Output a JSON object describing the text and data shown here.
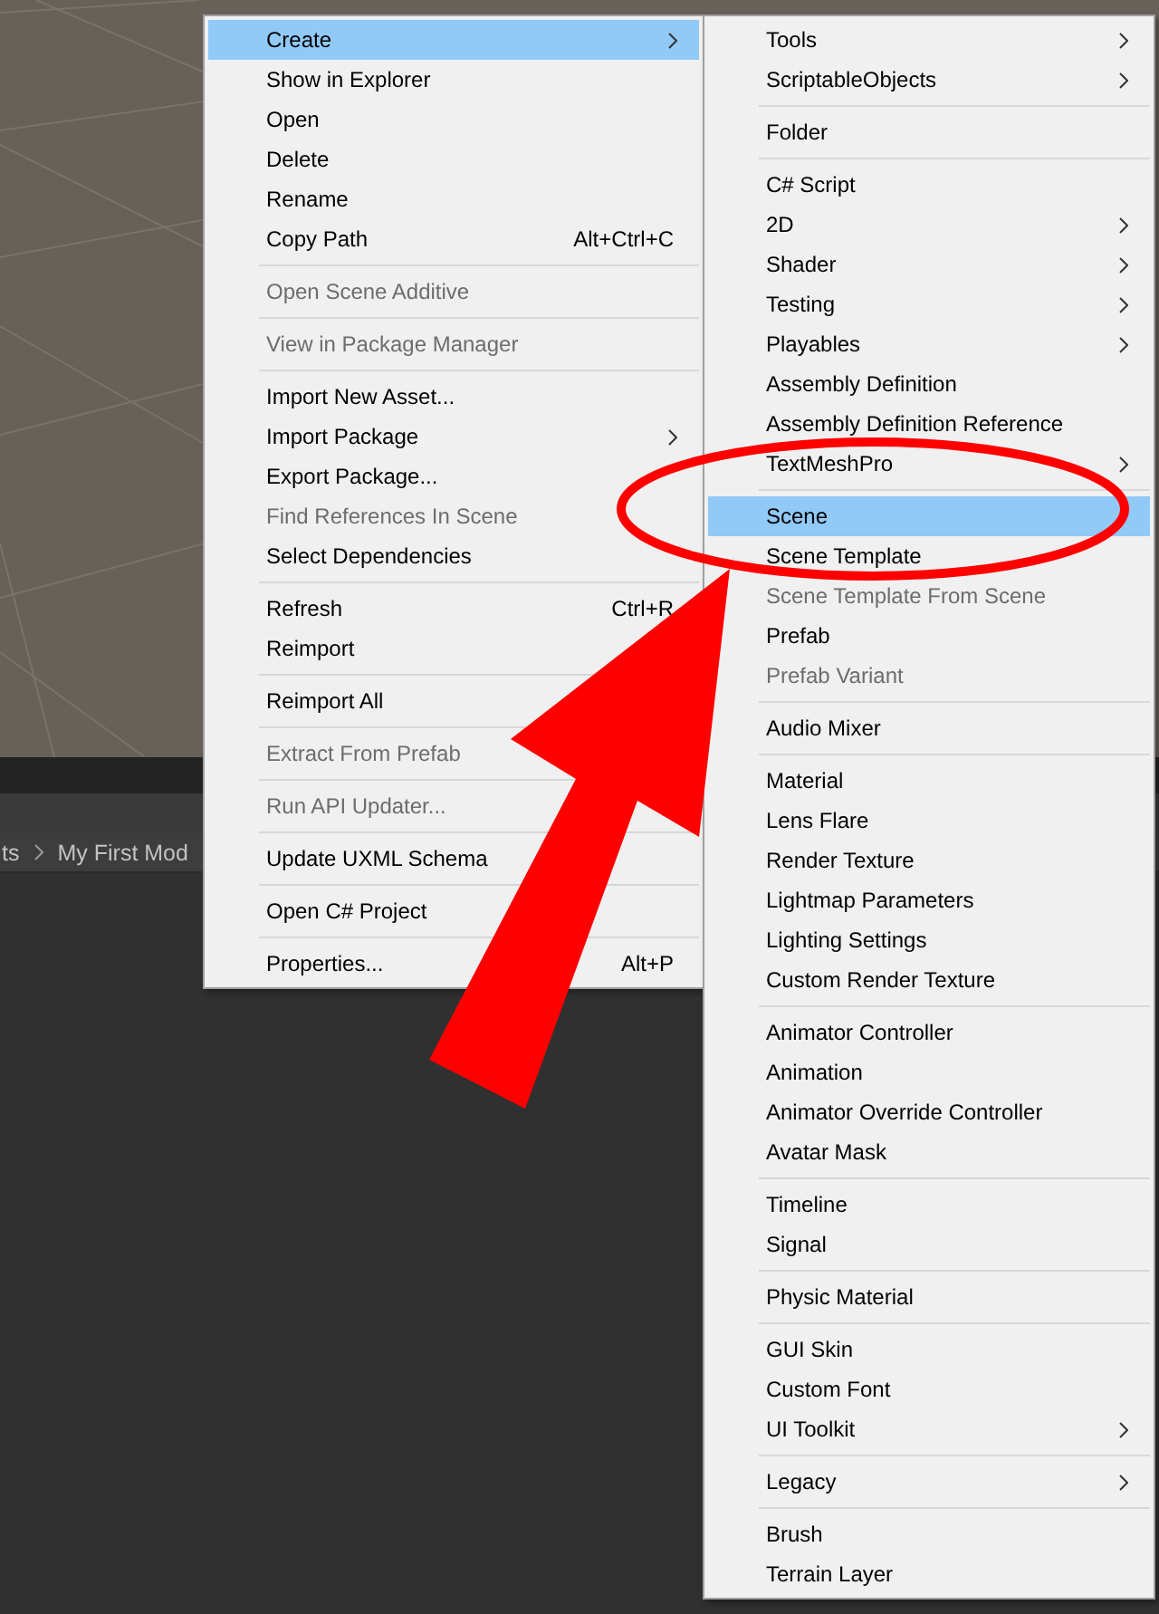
{
  "breadcrumb": [
    "ts",
    "My First Mod"
  ],
  "context_menu": {
    "groups": [
      {
        "items": [
          {
            "label": "Create",
            "submenu": true,
            "disabled": false,
            "selected": true
          },
          {
            "label": "Show in Explorer",
            "submenu": false,
            "disabled": false,
            "selected": false
          },
          {
            "label": "Open",
            "submenu": false,
            "disabled": false,
            "selected": false
          },
          {
            "label": "Delete",
            "submenu": false,
            "disabled": false,
            "selected": false
          },
          {
            "label": "Rename",
            "submenu": false,
            "disabled": false,
            "selected": false
          },
          {
            "label": "Copy Path",
            "shortcut": "Alt+Ctrl+C",
            "submenu": false,
            "disabled": false,
            "selected": false
          }
        ]
      },
      {
        "items": [
          {
            "label": "Open Scene Additive",
            "submenu": false,
            "disabled": true,
            "selected": false
          }
        ]
      },
      {
        "items": [
          {
            "label": "View in Package Manager",
            "submenu": false,
            "disabled": true,
            "selected": false
          }
        ]
      },
      {
        "items": [
          {
            "label": "Import New Asset...",
            "submenu": false,
            "disabled": false,
            "selected": false
          },
          {
            "label": "Import Package",
            "submenu": true,
            "disabled": false,
            "selected": false
          },
          {
            "label": "Export Package...",
            "submenu": false,
            "disabled": false,
            "selected": false
          },
          {
            "label": "Find References In Scene",
            "submenu": false,
            "disabled": true,
            "selected": false
          },
          {
            "label": "Select Dependencies",
            "submenu": false,
            "disabled": false,
            "selected": false
          }
        ]
      },
      {
        "items": [
          {
            "label": "Refresh",
            "shortcut": "Ctrl+R",
            "submenu": false,
            "disabled": false,
            "selected": false
          },
          {
            "label": "Reimport",
            "submenu": false,
            "disabled": false,
            "selected": false
          }
        ]
      },
      {
        "items": [
          {
            "label": "Reimport All",
            "submenu": false,
            "disabled": false,
            "selected": false
          }
        ]
      },
      {
        "items": [
          {
            "label": "Extract From Prefab",
            "submenu": false,
            "disabled": true,
            "selected": false
          }
        ]
      },
      {
        "items": [
          {
            "label": "Run API Updater...",
            "submenu": false,
            "disabled": true,
            "selected": false
          }
        ]
      },
      {
        "items": [
          {
            "label": "Update UXML Schema",
            "submenu": false,
            "disabled": false,
            "selected": false
          }
        ]
      },
      {
        "items": [
          {
            "label": "Open C# Project",
            "submenu": false,
            "disabled": false,
            "selected": false
          }
        ]
      },
      {
        "items": [
          {
            "label": "Properties...",
            "shortcut": "Alt+P",
            "submenu": false,
            "disabled": false,
            "selected": false
          }
        ]
      }
    ]
  },
  "create_submenu": {
    "groups": [
      {
        "items": [
          {
            "label": "Tools",
            "submenu": true,
            "disabled": false,
            "selected": false
          },
          {
            "label": "ScriptableObjects",
            "submenu": true,
            "disabled": false,
            "selected": false
          }
        ]
      },
      {
        "items": [
          {
            "label": "Folder",
            "submenu": false,
            "disabled": false,
            "selected": false
          }
        ]
      },
      {
        "items": [
          {
            "label": "C# Script",
            "submenu": false,
            "disabled": false,
            "selected": false
          },
          {
            "label": "2D",
            "submenu": true,
            "disabled": false,
            "selected": false
          },
          {
            "label": "Shader",
            "submenu": true,
            "disabled": false,
            "selected": false
          },
          {
            "label": "Testing",
            "submenu": true,
            "disabled": false,
            "selected": false
          },
          {
            "label": "Playables",
            "submenu": true,
            "disabled": false,
            "selected": false
          },
          {
            "label": "Assembly Definition",
            "submenu": false,
            "disabled": false,
            "selected": false
          },
          {
            "label": "Assembly Definition Reference",
            "submenu": false,
            "disabled": false,
            "selected": false
          },
          {
            "label": "TextMeshPro",
            "submenu": true,
            "disabled": false,
            "selected": false
          }
        ]
      },
      {
        "items": [
          {
            "label": "Scene",
            "submenu": false,
            "disabled": false,
            "selected": true
          },
          {
            "label": "Scene Template",
            "submenu": false,
            "disabled": false,
            "selected": false
          },
          {
            "label": "Scene Template From Scene",
            "submenu": false,
            "disabled": true,
            "selected": false
          },
          {
            "label": "Prefab",
            "submenu": false,
            "disabled": false,
            "selected": false
          },
          {
            "label": "Prefab Variant",
            "submenu": false,
            "disabled": true,
            "selected": false
          }
        ]
      },
      {
        "items": [
          {
            "label": "Audio Mixer",
            "submenu": false,
            "disabled": false,
            "selected": false
          }
        ]
      },
      {
        "items": [
          {
            "label": "Material",
            "submenu": false,
            "disabled": false,
            "selected": false
          },
          {
            "label": "Lens Flare",
            "submenu": false,
            "disabled": false,
            "selected": false
          },
          {
            "label": "Render Texture",
            "submenu": false,
            "disabled": false,
            "selected": false
          },
          {
            "label": "Lightmap Parameters",
            "submenu": false,
            "disabled": false,
            "selected": false
          },
          {
            "label": "Lighting Settings",
            "submenu": false,
            "disabled": false,
            "selected": false
          },
          {
            "label": "Custom Render Texture",
            "submenu": false,
            "disabled": false,
            "selected": false
          }
        ]
      },
      {
        "items": [
          {
            "label": "Animator Controller",
            "submenu": false,
            "disabled": false,
            "selected": false
          },
          {
            "label": "Animation",
            "submenu": false,
            "disabled": false,
            "selected": false
          },
          {
            "label": "Animator Override Controller",
            "submenu": false,
            "disabled": false,
            "selected": false
          },
          {
            "label": "Avatar Mask",
            "submenu": false,
            "disabled": false,
            "selected": false
          }
        ]
      },
      {
        "items": [
          {
            "label": "Timeline",
            "submenu": false,
            "disabled": false,
            "selected": false
          },
          {
            "label": "Signal",
            "submenu": false,
            "disabled": false,
            "selected": false
          }
        ]
      },
      {
        "items": [
          {
            "label": "Physic Material",
            "submenu": false,
            "disabled": false,
            "selected": false
          }
        ]
      },
      {
        "items": [
          {
            "label": "GUI Skin",
            "submenu": false,
            "disabled": false,
            "selected": false
          },
          {
            "label": "Custom Font",
            "submenu": false,
            "disabled": false,
            "selected": false
          },
          {
            "label": "UI Toolkit",
            "submenu": true,
            "disabled": false,
            "selected": false
          }
        ]
      },
      {
        "items": [
          {
            "label": "Legacy",
            "submenu": true,
            "disabled": false,
            "selected": false
          }
        ]
      },
      {
        "items": [
          {
            "label": "Brush",
            "submenu": false,
            "disabled": false,
            "selected": false
          },
          {
            "label": "Terrain Layer",
            "submenu": false,
            "disabled": false,
            "selected": false
          }
        ]
      }
    ]
  }
}
